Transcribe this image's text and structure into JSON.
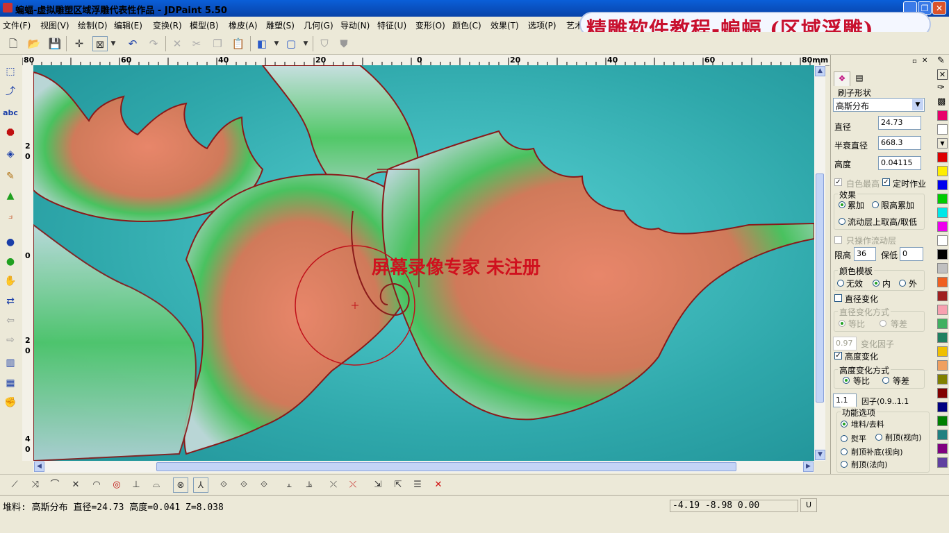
{
  "window": {
    "title": "蝙蝠-虚拟雕塑区域浮雕代表性作品 - JDPaint 5.50",
    "min": "_",
    "max": "❐",
    "close": "✕"
  },
  "overlay_banner": "精雕软件教程-蝙蝠 (区域浮雕)",
  "menu": [
    "文件(F)",
    "视图(V)",
    "绘制(D)",
    "编辑(E)",
    "变换(R)",
    "模型(B)",
    "橡皮(A)",
    "雕塑(S)",
    "几何(G)",
    "导动(N)",
    "特征(U)",
    "变形(O)",
    "颜色(C)",
    "效果(T)",
    "选项(P)",
    "艺术"
  ],
  "toolbar_icons": [
    "new-file-icon",
    "open-folder-icon",
    "save-icon",
    "crosshair-icon",
    "window-select-icon",
    "dropdown-arrow-icon",
    "undo-icon",
    "redo-icon",
    "delete-icon",
    "cut-icon",
    "copy-icon",
    "paste-icon",
    "box-view-icon",
    "dropdown-arrow-icon",
    "wire-box-icon",
    "dropdown-arrow-icon",
    "shield-icon",
    "shield-alt-icon"
  ],
  "ruler_top": {
    "labels": [
      "80",
      "60",
      "40",
      "20",
      "0",
      "20",
      "40",
      "60",
      "80mm"
    ]
  },
  "ruler_left": {
    "labels": [
      "2",
      "0",
      "0",
      "2",
      "0",
      "4",
      "0"
    ]
  },
  "watermark": "屏幕录像专家  未注册",
  "panel": {
    "brush_shape_label": "刷子形状",
    "brush_shape_value": "高斯分布",
    "diameter_label": "直径",
    "diameter_value": "24.73",
    "half_decay_label": "半衰直径",
    "half_decay_value": "668.3",
    "height_label": "高度",
    "height_value": "0.04115",
    "white_highest_label": "白色最高",
    "timed_label": "定时作业",
    "effect_title": "效果",
    "effect_accumulate": "累加",
    "effect_limit_accumulate": "限高累加",
    "effect_flow_layer": "流动层上取高/取低",
    "only_flow_layer": "只操作流动层",
    "limit_high_label": "限高",
    "limit_high_value": "36",
    "keep_low_label": "保低",
    "keep_low_value": "0",
    "color_template_title": "颜色模板",
    "ct_none": "无效",
    "ct_inner": "内",
    "ct_outer": "外",
    "diameter_change": "直径变化",
    "diameter_change_mode": "直径变化方式",
    "dc_ratio": "等比",
    "dc_diff": "等差",
    "change_factor_value": "0.97",
    "change_factor_label": "变化因子",
    "height_change": "高度变化",
    "height_change_mode": "高度变化方式",
    "hc_ratio": "等比",
    "hc_diff": "等差",
    "factor_value": "1.1",
    "factor_label": "因子(0.9..1.1",
    "func_title": "功能选项",
    "f_pile": "堆料/去料",
    "f_flatten": "熨平",
    "f_cut_top_view": "削顶(视向)",
    "f_cut_fill_view": "削顶补底(视向)",
    "f_cut_top_normal": "削顶(法向)"
  },
  "palette": [
    "#e8006a",
    "#ffffff",
    "#dd0000",
    "#ffee00",
    "#0000ee",
    "#00cc00",
    "#00e8e8",
    "#ee00ee",
    "#ffffff",
    "#000000",
    "#c0c0c0",
    "#f06020",
    "#a02020",
    "#f8a0b0",
    "#40b060",
    "#208060",
    "#f0c000",
    "#f0a060",
    "#808000",
    "#800000",
    "#000080",
    "#008000",
    "#208080",
    "#800080",
    "#6040a0"
  ],
  "status": {
    "left": "堆料: 高斯分布   直径=24.73   高度=0.041   Z=8.038",
    "coords": "-4.19 -8.98 0.00",
    "u_button": "U"
  },
  "colors": {
    "canvas_bg": "#2aa3a6",
    "relief_edge": "#8a1a1a",
    "relief_green": "#3fbf5a",
    "relief_red": "#e07a58",
    "brush_circle": "#c0101a"
  }
}
